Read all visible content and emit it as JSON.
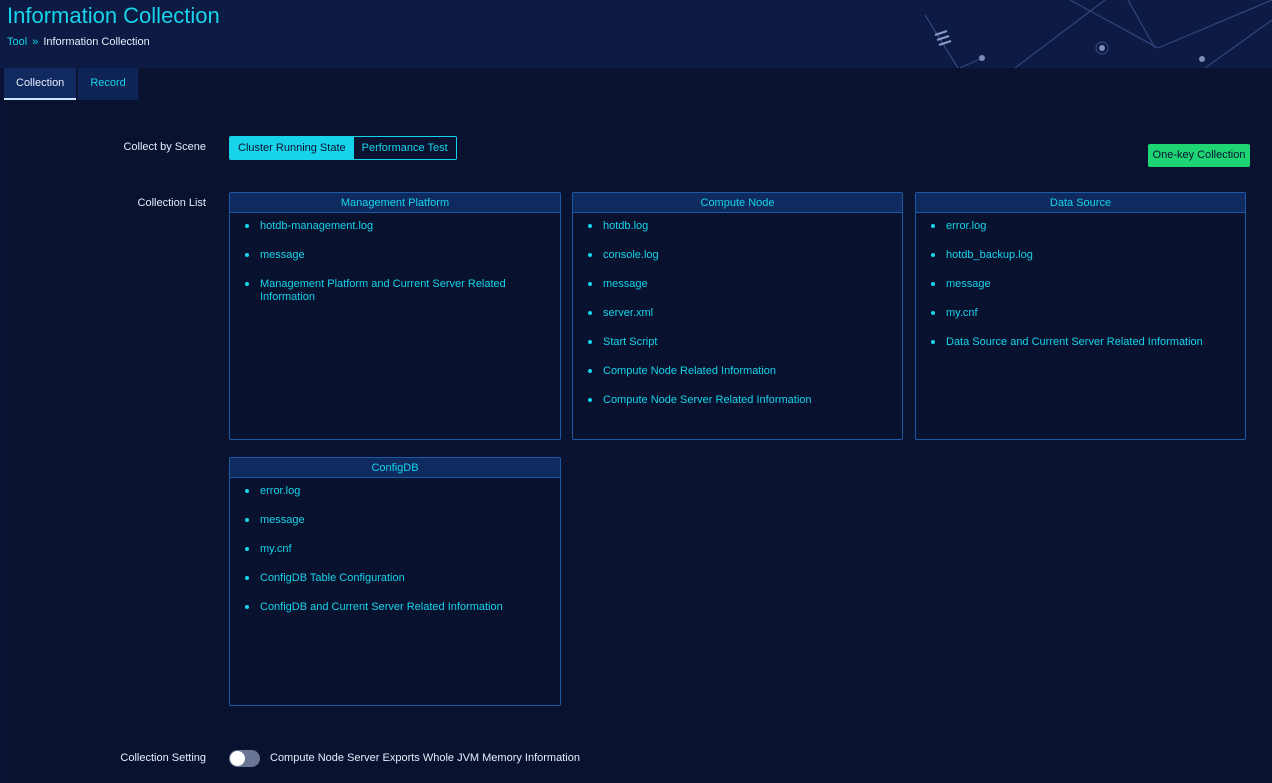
{
  "header": {
    "title": "Information Collection",
    "breadcrumb": {
      "parent": "Tool",
      "separator": "»",
      "current": "Information Collection"
    }
  },
  "tabs": [
    {
      "label": "Collection",
      "active": true
    },
    {
      "label": "Record",
      "active": false
    }
  ],
  "scene": {
    "label": "Collect by Scene",
    "options": [
      {
        "label": "Cluster Running State",
        "selected": true
      },
      {
        "label": "Performance Test",
        "selected": false
      }
    ]
  },
  "one_key_button": "One-key Collection",
  "collection_list": {
    "label": "Collection List",
    "cards": [
      {
        "title": "Management Platform",
        "items": [
          "hotdb-management.log",
          "message",
          "Management Platform and Current Server Related Information"
        ]
      },
      {
        "title": "Compute Node",
        "items": [
          "hotdb.log",
          "console.log",
          "message",
          "server.xml",
          "Start Script",
          "Compute Node Related Information",
          "Compute Node Server Related Information"
        ]
      },
      {
        "title": "Data Source",
        "items": [
          "error.log",
          "hotdb_backup.log",
          "message",
          "my.cnf",
          "Data Source and Current Server Related Information"
        ]
      },
      {
        "title": "ConfigDB",
        "items": [
          "error.log",
          "message",
          "my.cnf",
          "ConfigDB Table Configuration",
          "ConfigDB and Current Server Related Information"
        ]
      }
    ]
  },
  "setting": {
    "label": "Collection Setting",
    "toggle_on": false,
    "text": "Compute Node Server Exports Whole JVM Memory Information"
  },
  "colors": {
    "accent": "#17d4ea",
    "button_green": "#1ed573",
    "background": "#0a1233"
  }
}
